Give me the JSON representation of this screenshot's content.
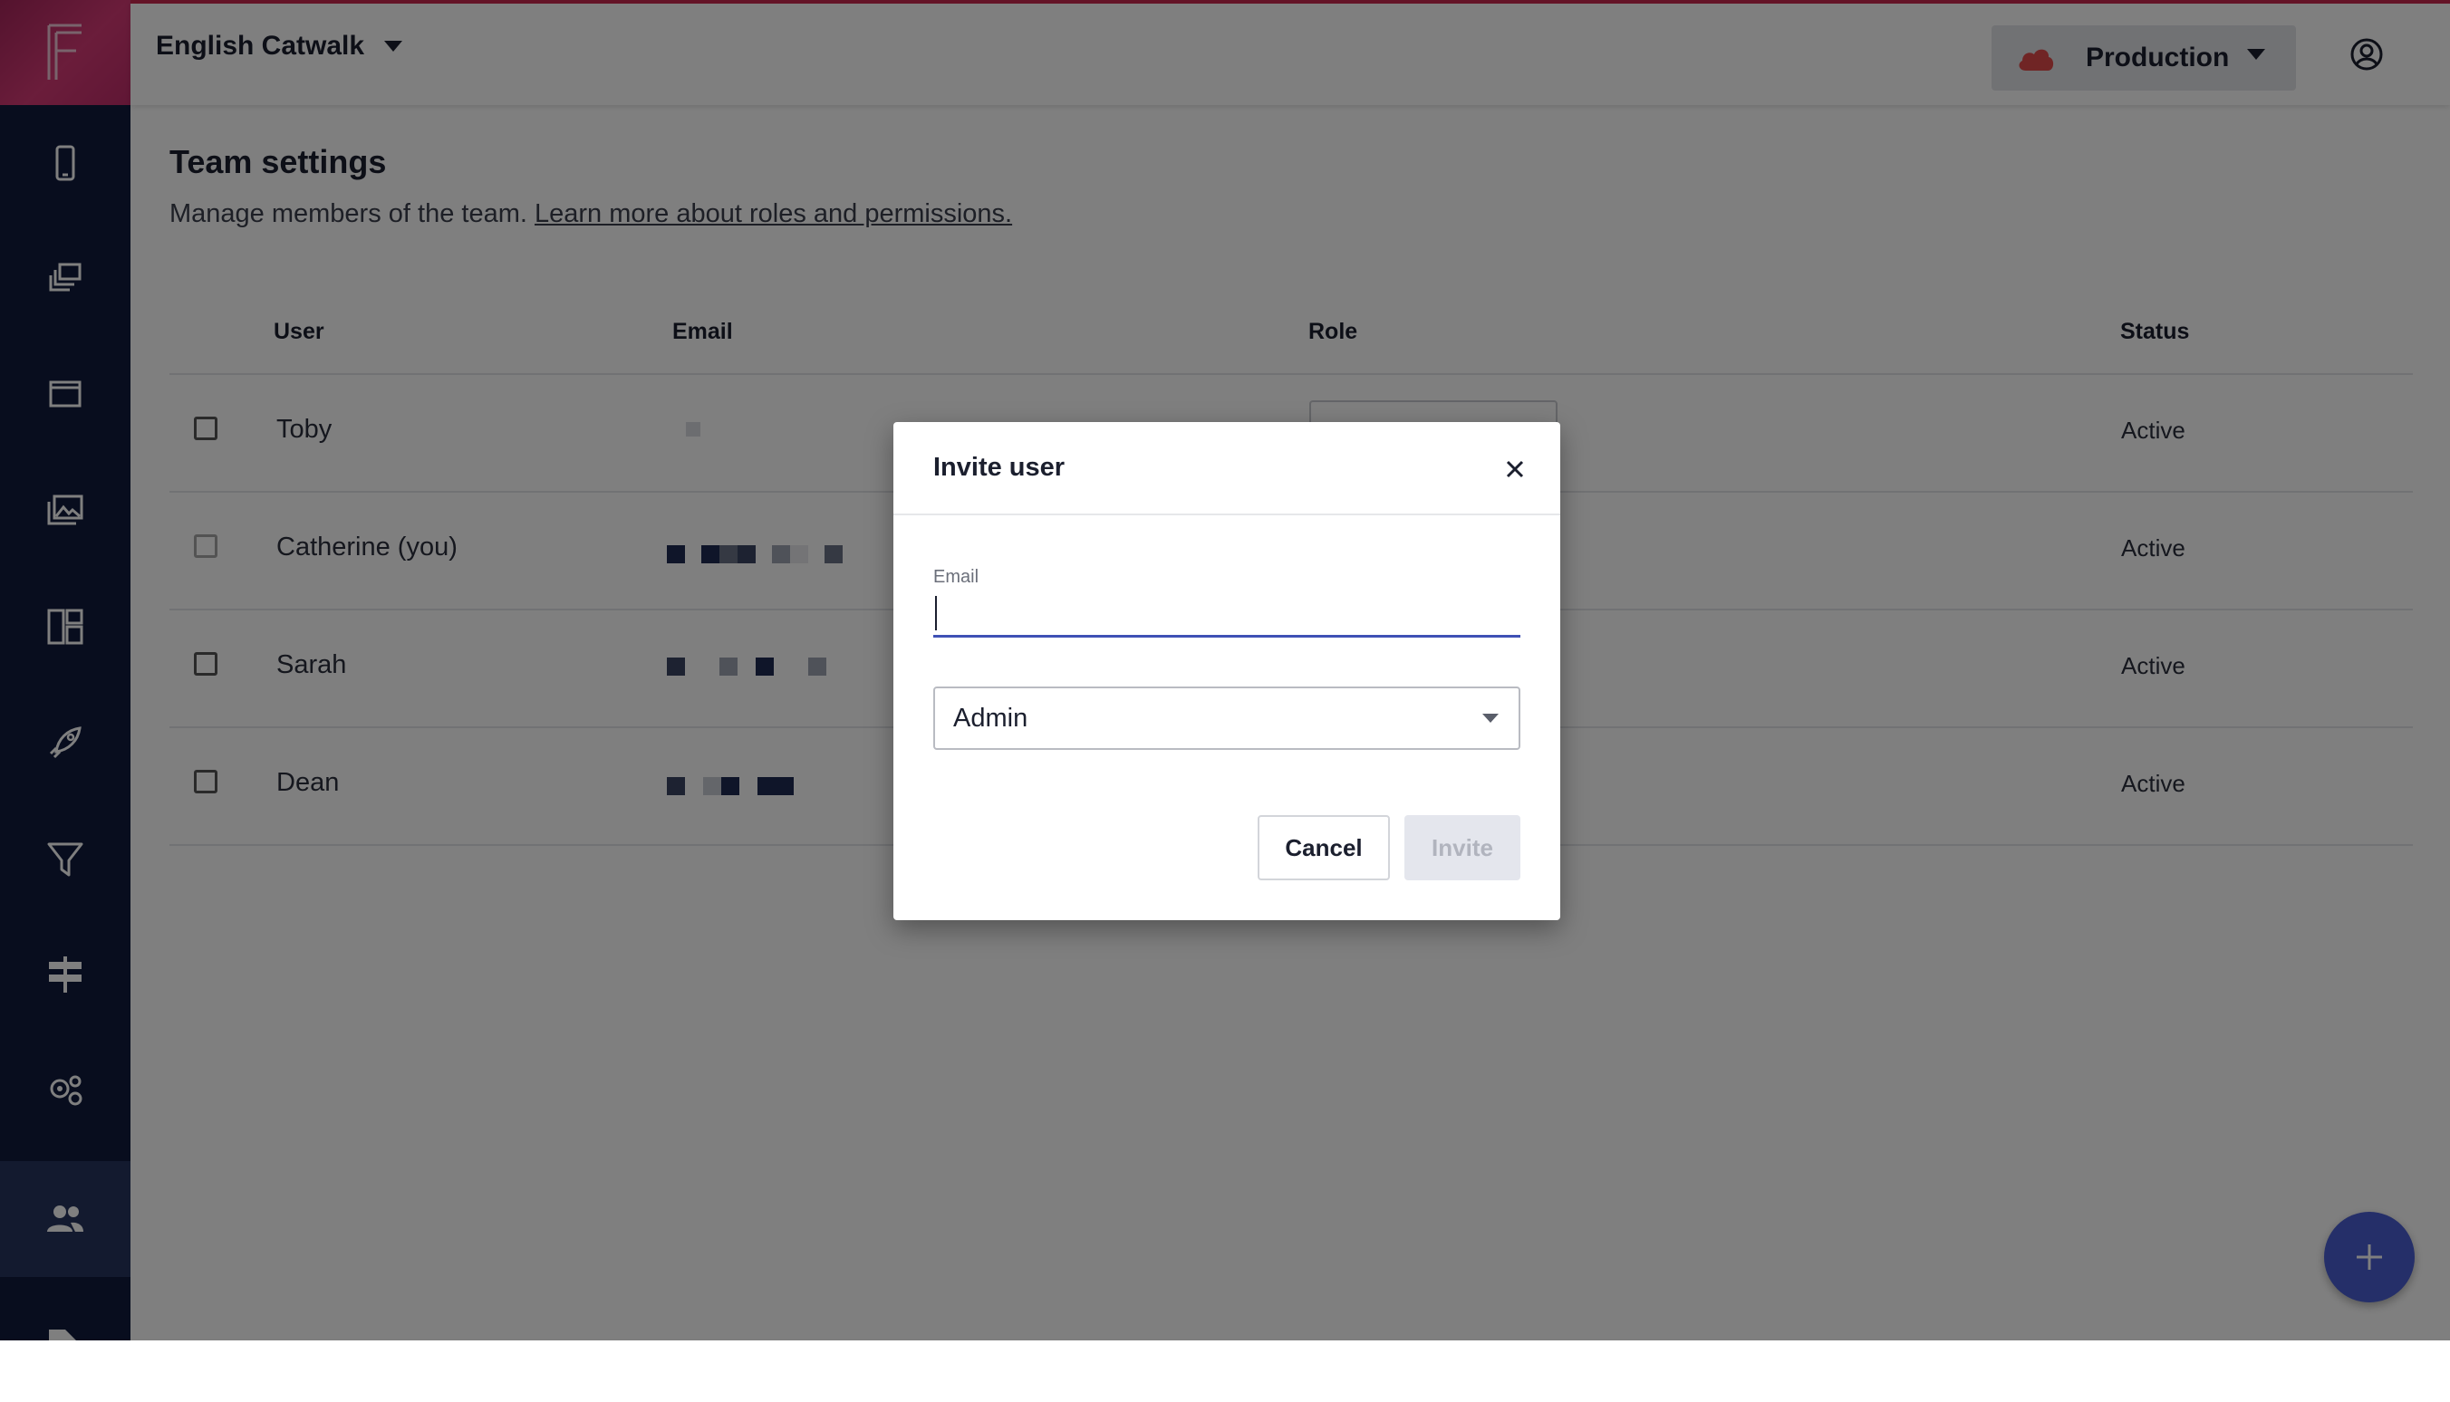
{
  "topbar": {
    "project_name": "English Catwalk",
    "environment": "Production"
  },
  "sidebar": {
    "items": [
      {
        "icon": "phone-icon"
      },
      {
        "icon": "layers-icon"
      },
      {
        "icon": "window-icon"
      },
      {
        "icon": "images-icon"
      },
      {
        "icon": "dashboard-icon"
      },
      {
        "icon": "rocket-icon"
      },
      {
        "icon": "funnel-icon"
      },
      {
        "icon": "signpost-icon"
      },
      {
        "icon": "gears-icon"
      },
      {
        "icon": "users-icon",
        "active": true
      },
      {
        "icon": "tag-icon"
      }
    ]
  },
  "page": {
    "title": "Team settings",
    "subtitle": "Manage members of the team.",
    "subtitle_link": "Learn more about roles and permissions."
  },
  "table": {
    "headers": {
      "user": "User",
      "email": "Email",
      "role": "Role",
      "status": "Status"
    },
    "rows": [
      {
        "user": "Toby",
        "status": "Active"
      },
      {
        "user": "Catherine (you)",
        "status": "Active"
      },
      {
        "user": "Sarah",
        "status": "Active"
      },
      {
        "user": "Dean",
        "status": "Active"
      }
    ]
  },
  "modal": {
    "title": "Invite user",
    "email_label": "Email",
    "email_value": "",
    "role_value": "Admin",
    "cancel_label": "Cancel",
    "invite_label": "Invite"
  },
  "colors": {
    "sidebar": "#101a3d",
    "brand_gradient_start": "#a8265c",
    "brand_gradient_end": "#d63a76",
    "accent_line": "#3f51b5",
    "fab": "#4a5fd3",
    "env_cloud": "#e04a4a"
  }
}
